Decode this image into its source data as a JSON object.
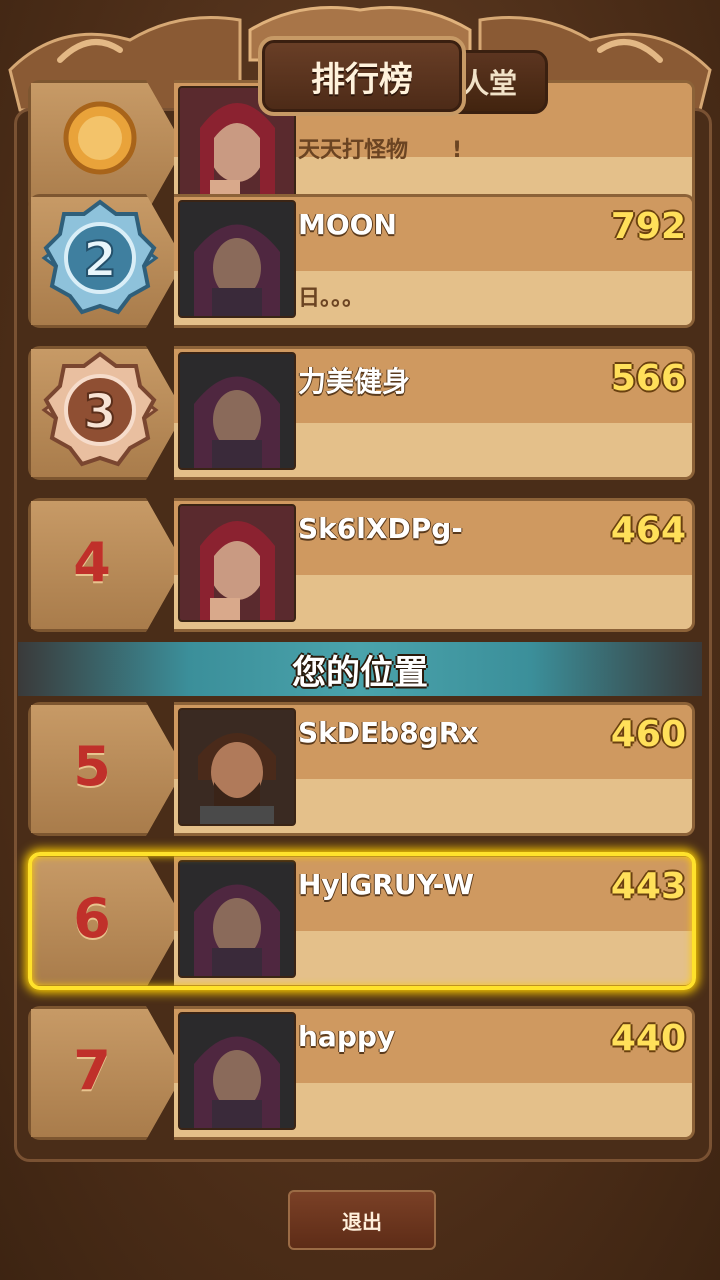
{
  "tabs": [
    {
      "label": "排行榜",
      "active": true
    },
    {
      "label": "人堂",
      "active": false
    }
  ],
  "entries": [
    {
      "rank": "1",
      "name": "",
      "score": "",
      "message": "天天打怪物　　!",
      "portrait": "female-warrior"
    },
    {
      "rank": "2",
      "name": "MOON",
      "score": "792",
      "message": "日。。。",
      "portrait": "hooded-man",
      "medal": "silver"
    },
    {
      "rank": "3",
      "name": "力美健身",
      "score": "566",
      "message": "",
      "portrait": "hooded-man",
      "medal": "bronze"
    },
    {
      "rank": "4",
      "name": "Sk6lXDPg-",
      "score": "464",
      "message": "",
      "portrait": "female-warrior"
    },
    {
      "rank": "5",
      "name": "SkDEb8gRx",
      "score": "460",
      "message": "",
      "portrait": "bearded-man"
    },
    {
      "rank": "6",
      "name": "HylGRUY-W",
      "score": "443",
      "message": "",
      "portrait": "hooded-man",
      "highlighted": true
    },
    {
      "rank": "7",
      "name": "happy",
      "score": "440",
      "message": "",
      "portrait": "hooded-man"
    }
  ],
  "your_position_label": "您的位置",
  "exit_label": "退出",
  "colors": {
    "rank_number": "#c0302a",
    "score": "#ffe05a",
    "highlight": "#ffe22b",
    "divider": "#4aa3ab"
  }
}
